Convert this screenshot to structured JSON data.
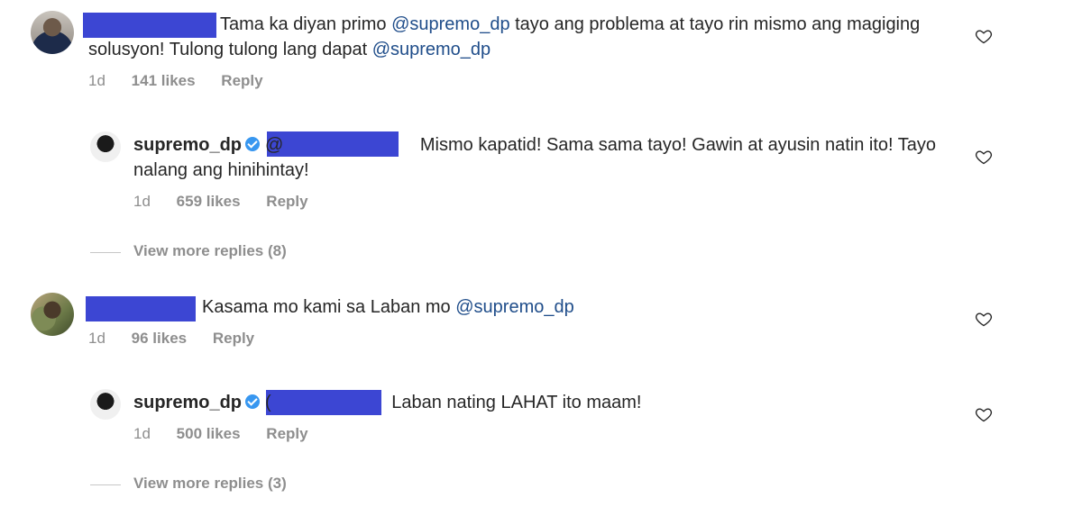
{
  "comments": [
    {
      "text_start": "Tama ka diyan primo ",
      "mention1": "@supremo_dp",
      "text_mid": " tayo ang problema at tayo rin mismo ang magiging solusyon! Tulong tulong lang dapat ",
      "mention2": "@supremo_dp",
      "time": "1d",
      "likes": "141 likes",
      "reply_label": "Reply",
      "reply": {
        "username": "supremo_dp",
        "mention_prefix": "@",
        "text": " Mismo kapatid! Sama sama tayo! Gawin at ayusin natin ito! Tayo nalang ang hinihintay!",
        "time": "1d",
        "likes": "659 likes",
        "reply_label": "Reply"
      },
      "view_more": "View more replies (8)"
    },
    {
      "text_start": "Kasama mo kami sa Laban mo ",
      "mention1": "@supremo_dp",
      "time": "1d",
      "likes": "96 likes",
      "reply_label": "Reply",
      "reply": {
        "username": "supremo_dp",
        "mention_prefix": "(",
        "text": " Laban nating LAHAT ito maam!",
        "time": "1d",
        "likes": "500 likes",
        "reply_label": "Reply"
      },
      "view_more": "View more replies (3)"
    }
  ],
  "icons": {
    "like": "heart-outline-icon",
    "verified": "verified-badge-icon"
  },
  "colors": {
    "redaction": "#3c46d3",
    "mention": "#1f4d8a",
    "verified": "#3897f0",
    "muted": "#8e8e8e"
  }
}
